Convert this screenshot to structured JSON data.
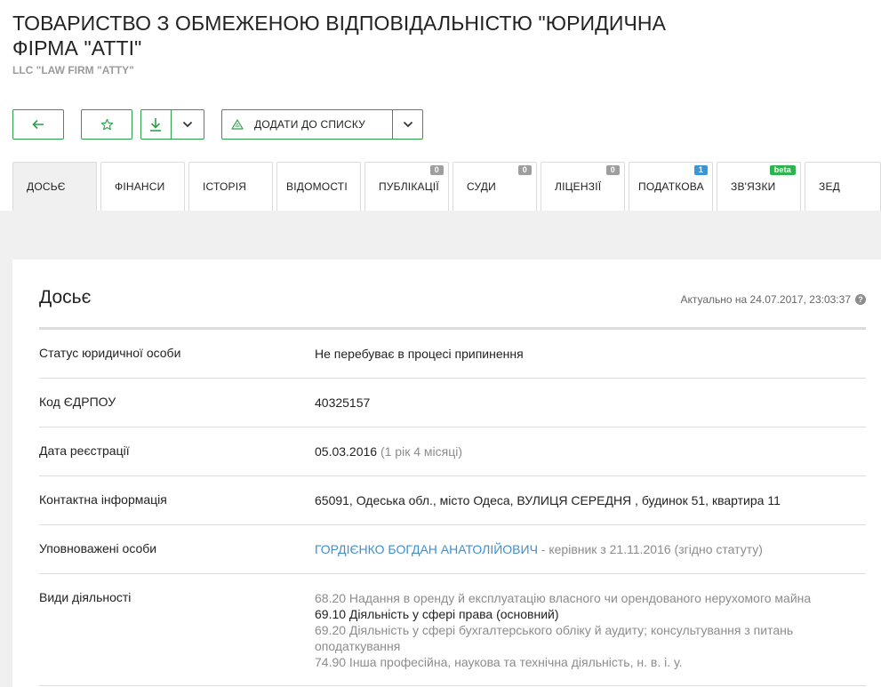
{
  "company": {
    "title": "ТОВАРИСТВО З ОБМЕЖЕНОЮ ВІДПОВІДАЛЬНІСТЮ \"ЮРИДИЧНА ФІРМА \"АТТІ\"",
    "subtitle": "LLC \"LAW FIRM \"ATTY\""
  },
  "toolbar": {
    "add_to_list_label": "ДОДАТИ ДО СПИСКУ"
  },
  "tabs": [
    {
      "label": "ДОСЬЄ",
      "active": true
    },
    {
      "label": "ФІНАНСИ"
    },
    {
      "label": "ІСТОРІЯ"
    },
    {
      "label": "ВІДОМОСТІ"
    },
    {
      "label": "ПУБЛІКАЦІЇ",
      "badge": "0"
    },
    {
      "label": "СУДИ",
      "badge": "0"
    },
    {
      "label": "ЛІЦЕНЗІЇ",
      "badge": "0"
    },
    {
      "label": "ПОДАТКОВА",
      "badge": "1"
    },
    {
      "label": "ЗВ'ЯЗКИ",
      "badge": "beta"
    },
    {
      "label": "ЗЕД"
    }
  ],
  "dossier": {
    "title": "Досьє",
    "actual": "Актуально на 24.07.2017, 23:03:37",
    "rows": {
      "status": {
        "label": "Статус юридичної особи",
        "value": "Не перебуває в процесі припинення"
      },
      "edrpou": {
        "label": "Код ЄДРПОУ",
        "value": "40325157"
      },
      "registration": {
        "label": "Дата реєстрації",
        "date": "05.03.2016",
        "age": "(1 рік 4 місяці)"
      },
      "contact": {
        "label": "Контактна інформація",
        "value": "65091, Одеська обл., місто Одеса, ВУЛИЦЯ СЕРЕДНЯ , будинок 51, квартира 11"
      },
      "authorized": {
        "label": "Уповноважені особи",
        "person": "ГОРДІЄНКО БОГДАН АНАТОЛІЙОВИЧ",
        "role": "- керівник з 21.11.2016 (згідно статуту)"
      },
      "activities": {
        "label": "Види діяльності",
        "items": [
          "68.20 Надання в оренду й експлуатацію власного чи орендованого нерухомого майна",
          "69.10 Діяльність у сфері права (основний)",
          "69.20 Діяльність у сфері бухгалтерського обліку й аудиту; консультування з питань оподаткування",
          "74.90 Інша професійна, наукова та технічна діяльність, н. в. і. у."
        ]
      }
    }
  }
}
